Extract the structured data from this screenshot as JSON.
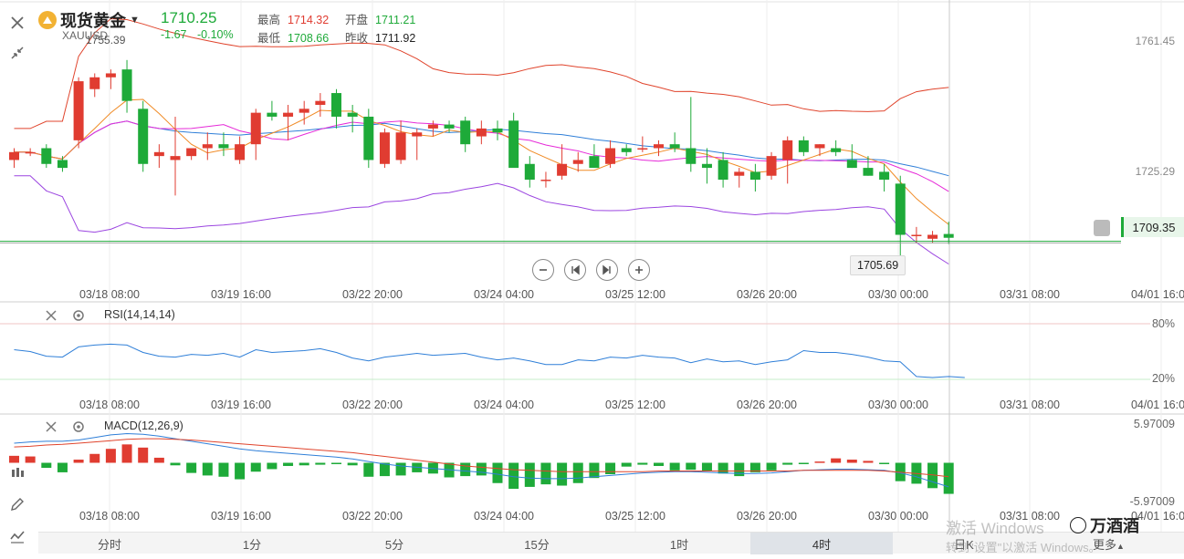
{
  "header": {
    "title": "现货黄金",
    "symbol": "XAUUSD",
    "price": "1710.25",
    "change": "-1.67",
    "change_pct": "-0.10%",
    "high_label": "最高",
    "high": "1714.32",
    "open_label": "开盘",
    "open": "1711.21",
    "low_label": "最低",
    "low": "1708.66",
    "prev_label": "昨收",
    "prev": "1711.92"
  },
  "colors": {
    "up": "#e03c31",
    "down": "#1eaa39",
    "ma5": "#f08a24",
    "ma10": "#e62ad8",
    "ma20": "#2f7fd8",
    "boll": "#9b45e0",
    "upper": "#e0442c"
  },
  "icons": [
    "close-icon",
    "collapse-icon",
    "candlestick-icon",
    "pencil-icon",
    "indicator-icon",
    "bell-icon",
    "zoom-out-icon",
    "first-icon",
    "last-icon",
    "zoom-in-icon",
    "settings-icon"
  ],
  "main_chart": {
    "y_labels": [
      "1761.45",
      "1725.29"
    ],
    "max_tag": "1755.39",
    "min_tag": "1705.69",
    "current_price": "1709.35"
  },
  "x_ticks": [
    "03/18 08:00",
    "03/19 16:00",
    "03/22 20:00",
    "03/24 04:00",
    "03/25 12:00",
    "03/26 20:00",
    "03/30 00:00",
    "03/31 08:00",
    "04/01 16:00"
  ],
  "rsi": {
    "label": "RSI(14,14,14)",
    "upper": "80%",
    "lower": "20%"
  },
  "macd": {
    "label": "MACD(12,26,9)",
    "upper": "5.97009",
    "lower": "-5.97009"
  },
  "periods": [
    "分时",
    "1分",
    "5分",
    "15分",
    "1时",
    "4时",
    "日K"
  ],
  "active_period": "4时",
  "more_label": "更多",
  "watermark": {
    "line1": "激活 Windows",
    "line2": "转到\"设置\"以激活 Windows。"
  },
  "wechat_account": "万酒酒",
  "chart_data": {
    "type": "candlestick",
    "candles": [
      [
        1730,
        1733,
        1728,
        1732
      ],
      [
        1732,
        1733,
        1731,
        1732
      ],
      [
        1733,
        1734,
        1728,
        1729
      ],
      [
        1730,
        1731,
        1727,
        1728
      ],
      [
        1735,
        1751,
        1733,
        1750
      ],
      [
        1748,
        1752,
        1746,
        1751
      ],
      [
        1751,
        1753,
        1748,
        1752
      ],
      [
        1753,
        1755.39,
        1742,
        1745
      ],
      [
        1743,
        1745,
        1727,
        1729
      ],
      [
        1731,
        1734,
        1728,
        1732
      ],
      [
        1730,
        1741,
        1721,
        1731
      ],
      [
        1731,
        1733,
        1730,
        1733
      ],
      [
        1733,
        1737,
        1730,
        1734
      ],
      [
        1734,
        1737,
        1731,
        1733
      ],
      [
        1730,
        1736,
        1729,
        1734
      ],
      [
        1734,
        1743,
        1730,
        1742
      ],
      [
        1742,
        1745,
        1740,
        1741
      ],
      [
        1741,
        1744,
        1735,
        1742
      ],
      [
        1742,
        1745,
        1739,
        1743
      ],
      [
        1744,
        1747,
        1741,
        1745
      ],
      [
        1747,
        1748,
        1738,
        1741
      ],
      [
        1742,
        1744,
        1737,
        1741
      ],
      [
        1741,
        1743,
        1728,
        1730
      ],
      [
        1729,
        1738,
        1728,
        1737
      ],
      [
        1730,
        1740,
        1729,
        1737
      ],
      [
        1736,
        1738,
        1730,
        1737
      ],
      [
        1738,
        1740,
        1736,
        1739
      ],
      [
        1739,
        1740,
        1737,
        1738
      ],
      [
        1740,
        1741,
        1732,
        1734
      ],
      [
        1736,
        1740,
        1734,
        1738
      ],
      [
        1738,
        1740,
        1735,
        1737
      ],
      [
        1740,
        1742,
        1732,
        1728
      ],
      [
        1729,
        1731,
        1723,
        1725
      ],
      [
        1725,
        1727,
        1723,
        1725
      ],
      [
        1726,
        1734,
        1725,
        1729
      ],
      [
        1729,
        1732,
        1727,
        1730
      ],
      [
        1731,
        1734,
        1728,
        1728
      ],
      [
        1729,
        1735,
        1728,
        1733
      ],
      [
        1733,
        1734,
        1731,
        1732
      ],
      [
        1733,
        1736,
        1732,
        1733
      ],
      [
        1733,
        1735,
        1731,
        1734
      ],
      [
        1734,
        1737,
        1732,
        1733
      ],
      [
        1733,
        1746,
        1727,
        1729
      ],
      [
        1729,
        1733,
        1724,
        1728
      ],
      [
        1730,
        1732,
        1723,
        1725
      ],
      [
        1726,
        1728,
        1723,
        1727
      ],
      [
        1727,
        1729,
        1722,
        1725
      ],
      [
        1726,
        1732,
        1725,
        1731
      ],
      [
        1730,
        1736,
        1724,
        1735
      ],
      [
        1735,
        1736,
        1731,
        1732
      ],
      [
        1733,
        1734,
        1731,
        1734
      ],
      [
        1733,
        1735,
        1731,
        1732
      ],
      [
        1730,
        1734,
        1728,
        1728
      ],
      [
        1728,
        1731,
        1726,
        1726
      ],
      [
        1727,
        1729,
        1722,
        1725
      ],
      [
        1724,
        1726,
        1705.69,
        1711
      ],
      [
        1711,
        1713,
        1709,
        1711
      ],
      [
        1710,
        1712,
        1709,
        1711
      ],
      [
        1711.21,
        1714.32,
        1708.66,
        1710.25
      ]
    ],
    "ylim": [
      1700,
      1766
    ],
    "rsi_values": [
      52,
      50,
      45,
      44,
      55,
      57,
      58,
      57,
      49,
      45,
      44,
      47,
      46,
      48,
      44,
      52,
      49,
      50,
      51,
      53,
      49,
      43,
      40,
      44,
      46,
      48,
      46,
      47,
      48,
      44,
      41,
      43,
      40,
      36,
      36,
      41,
      40,
      44,
      43,
      46,
      44,
      43,
      38,
      42,
      39,
      40,
      36,
      39,
      41,
      51,
      49,
      49,
      47,
      44,
      40,
      39,
      23,
      22,
      23,
      22
    ],
    "macd_hist": [
      1.1,
      1.0,
      -0.8,
      -1.5,
      0.5,
      1.4,
      2.2,
      2.9,
      2.4,
      0.8,
      -0.4,
      -1.6,
      -2.0,
      -2.2,
      -2.6,
      -1.4,
      -1.0,
      -0.5,
      -0.4,
      -0.3,
      -0.2,
      -0.4,
      -2.2,
      -2.1,
      -2.0,
      -1.5,
      -1.7,
      -2.3,
      -2.1,
      -2.0,
      -3.2,
      -4.1,
      -3.8,
      -3.4,
      -3.6,
      -3.2,
      -2.4,
      -1.8,
      -0.6,
      -0.3,
      -0.5,
      -1.2,
      -1.1,
      -1.3,
      -1.7,
      -2.1,
      -1.5,
      -1.2,
      -0.3,
      -0.2,
      0.2,
      0.7,
      0.5,
      0.3,
      -0.2,
      -2.9,
      -3.3,
      -4.0,
      -4.9
    ],
    "macd_dif": [
      3.1,
      3.3,
      3.4,
      3.4,
      3.6,
      4.0,
      4.4,
      4.6,
      4.5,
      4.2,
      3.8,
      3.4,
      3.0,
      2.6,
      2.2,
      1.9,
      1.7,
      1.5,
      1.3,
      1.1,
      0.9,
      0.6,
      0.2,
      -0.2,
      -0.5,
      -0.7,
      -0.9,
      -1.1,
      -1.3,
      -1.5,
      -1.8,
      -2.2,
      -2.4,
      -2.5,
      -2.5,
      -2.4,
      -2.2,
      -2.0,
      -1.8,
      -1.6,
      -1.5,
      -1.4,
      -1.4,
      -1.5,
      -1.6,
      -1.7,
      -1.7,
      -1.6,
      -1.4,
      -1.2,
      -1.1,
      -1.0,
      -1.0,
      -1.1,
      -1.2,
      -1.6,
      -2.2,
      -3.0,
      -3.8
    ],
    "macd_dea": [
      2.5,
      2.6,
      2.8,
      2.9,
      3.1,
      3.3,
      3.5,
      3.7,
      3.8,
      3.8,
      3.7,
      3.6,
      3.4,
      3.2,
      3.0,
      2.8,
      2.6,
      2.4,
      2.2,
      2.0,
      1.8,
      1.6,
      1.3,
      1.0,
      0.7,
      0.4,
      0.1,
      -0.2,
      -0.5,
      -0.7,
      -0.9,
      -1.1,
      -1.2,
      -1.3,
      -1.4,
      -1.4,
      -1.4,
      -1.4,
      -1.4,
      -1.4,
      -1.3,
      -1.3,
      -1.3,
      -1.3,
      -1.3,
      -1.3,
      -1.3,
      -1.3,
      -1.3,
      -1.2,
      -1.2,
      -1.2,
      -1.2,
      -1.2,
      -1.3,
      -1.5,
      -1.7,
      -1.9,
      -2.2
    ],
    "macd_ylim": [
      -5.97009,
      5.97009
    ]
  }
}
